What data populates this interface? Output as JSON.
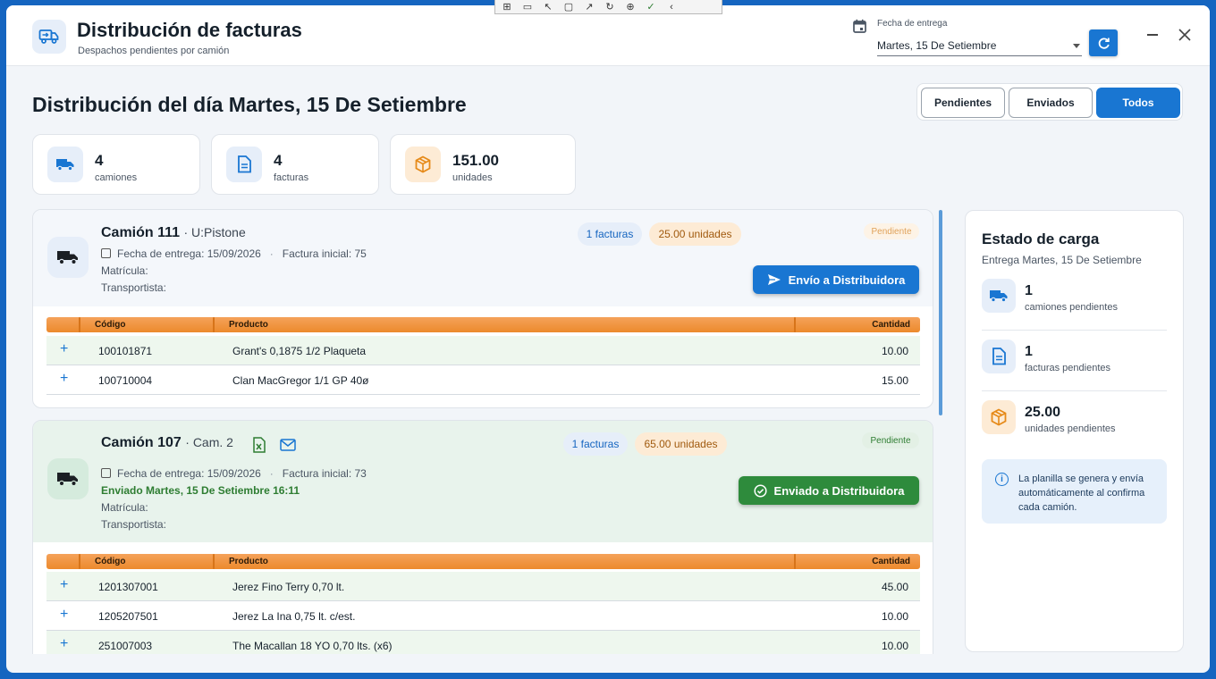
{
  "app": {
    "title": "Distribución de facturas",
    "subtitle": "Despachos pendientes por camión"
  },
  "date_picker": {
    "label": "Fecha de entrega",
    "value": "Martes, 15 De Setiembre"
  },
  "page": {
    "title": "Distribución del día Martes, 15 De Setiembre"
  },
  "filters": [
    {
      "label": "Pendientes",
      "active": false
    },
    {
      "label": "Enviados",
      "active": false
    },
    {
      "label": "Todos",
      "active": true
    }
  ],
  "stats": [
    {
      "value": "4",
      "label": "camiones",
      "icon": "truck-icon",
      "color": "#1976d2"
    },
    {
      "value": "4",
      "label": "facturas",
      "icon": "document-icon",
      "color": "#1976d2"
    },
    {
      "value": "151.00",
      "label": "unidades",
      "icon": "box-icon",
      "color": "#e68a19"
    }
  ],
  "trucks": [
    {
      "name": "Camión 111",
      "driver": "· U:Pistone",
      "fecha": "Fecha de entrega: 15/09/2026",
      "factura": "Factura inicial: 75",
      "matricula": "Matrícula:",
      "transportista": "Transportista:",
      "facturas_pill": "1 facturas",
      "unidades_pill": "25.00 unidades",
      "status": "Pendiente",
      "action": "Envío a Distribuidora",
      "columns": {
        "codigo": "Código",
        "producto": "Producto",
        "cantidad": "Cantidad"
      },
      "rows": [
        {
          "codigo": "100101871",
          "producto": "Grant's 0,1875 1/2 Plaqueta",
          "cantidad": "10.00"
        },
        {
          "codigo": "100710004",
          "producto": "Clan MacGregor 1/1 GP 40ø",
          "cantidad": "15.00"
        }
      ]
    },
    {
      "name": "Camión 107",
      "driver": "· Cam. 2",
      "fecha": "Fecha de entrega: 15/09/2026",
      "factura": "Factura inicial: 73",
      "sent": "Enviado Martes, 15 De Setiembre 16:11",
      "matricula": "Matrícula:",
      "transportista": "Transportista:",
      "facturas_pill": "1 facturas",
      "unidades_pill": "65.00 unidades",
      "status": "Pendiente",
      "action": "Enviado a Distribuidora",
      "columns": {
        "codigo": "Código",
        "producto": "Producto",
        "cantidad": "Cantidad"
      },
      "rows": [
        {
          "codigo": "1201307001",
          "producto": "Jerez Fino Terry 0,70 lt.",
          "cantidad": "45.00"
        },
        {
          "codigo": "1205207501",
          "producto": "Jerez La Ina 0,75 lt. c/est.",
          "cantidad": "10.00"
        },
        {
          "codigo": "251007003",
          "producto": "The Macallan 18 YO 0,70 lts. (x6)",
          "cantidad": "10.00"
        }
      ]
    }
  ],
  "sidebar": {
    "title": "Estado de carga",
    "subtitle": "Entrega Martes, 15 De Setiembre",
    "items": [
      {
        "value": "1",
        "label": "camiones pendientes",
        "icon": "truck-icon"
      },
      {
        "value": "1",
        "label": "facturas pendientes",
        "icon": "document-icon"
      },
      {
        "value": "25.00",
        "label": "unidades pendientes",
        "icon": "box-icon"
      }
    ],
    "info": "La planilla se genera y envía automáticamente al confirma cada camión."
  }
}
